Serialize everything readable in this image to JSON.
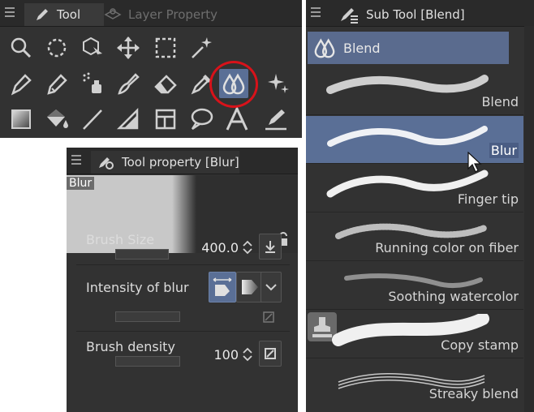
{
  "tool_panel": {
    "tabs": [
      {
        "label": "Tool",
        "active": true
      },
      {
        "label": "Layer Property",
        "active": false
      }
    ],
    "tools": [
      [
        "zoom-icon",
        "rotate-icon",
        "object-icon",
        "move-icon",
        "selection-icon",
        "auto-select-icon"
      ],
      [
        "pen-icon",
        "pencil-icon",
        "airbrush-icon",
        "brush-icon",
        "eraser-icon",
        "eyedropper-icon",
        "blend-icon",
        "decoration-icon"
      ],
      [
        "gradient-icon",
        "fill-icon",
        "line-icon",
        "ruler-icon",
        "frame-icon",
        "balloon-icon",
        "text-icon",
        "correct-line-icon"
      ]
    ],
    "selected_tool": "blend-icon"
  },
  "property_panel": {
    "title": "Tool property [Blur]",
    "preview_tag": "Blur",
    "brush_size": {
      "label": "Brush Size",
      "value": "400.0"
    },
    "intensity": {
      "label": "Intensity of blur"
    },
    "density": {
      "label": "Brush density",
      "value": "100"
    }
  },
  "sub_tool_panel": {
    "title": "Sub Tool [Blend]",
    "group": "Blend",
    "items": [
      {
        "label": "Blend",
        "selected": false
      },
      {
        "label": "Blur",
        "selected": true
      },
      {
        "label": "Finger tip",
        "selected": false
      },
      {
        "label": "Running color on fiber",
        "selected": false
      },
      {
        "label": "Soothing watercolor",
        "selected": false
      },
      {
        "label": "Copy stamp",
        "selected": false
      },
      {
        "label": "Streaky blend",
        "selected": false
      }
    ]
  },
  "colors": {
    "selection": "#5a6f96",
    "panel": "#323232",
    "highlight_ring": "#d8121a"
  }
}
